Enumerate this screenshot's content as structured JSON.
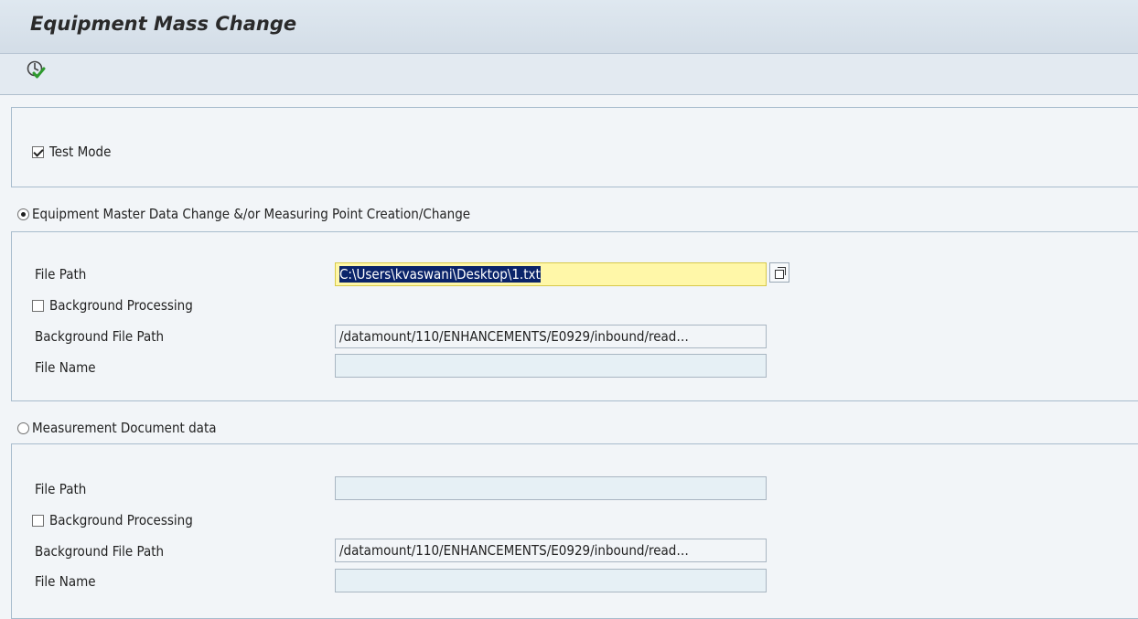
{
  "header": {
    "title": "Equipment Mass Change"
  },
  "toolbar": {
    "execute_icon": "execute-icon"
  },
  "options": {
    "test_mode_label": "Test Mode",
    "test_mode_checked": true
  },
  "section1": {
    "radio_label": "Equipment Master Data Change &/or Measuring Point Creation/Change",
    "selected": true,
    "file_path_label": "File Path",
    "file_path_value": "C:\\Users\\kvaswani\\Desktop\\1.txt",
    "background_processing_label": "Background Processing",
    "background_processing_checked": false,
    "background_file_path_label": "Background File Path",
    "background_file_path_value": "/datamount/110/ENHANCEMENTS/E0929/inbound/read…",
    "file_name_label": "File Name",
    "file_name_value": ""
  },
  "section2": {
    "radio_label": "Measurement Document data",
    "selected": false,
    "file_path_label": "File Path",
    "file_path_value": "",
    "background_processing_label": "Background Processing",
    "background_processing_checked": false,
    "background_file_path_label": "Background File Path",
    "background_file_path_value": "/datamount/110/ENHANCEMENTS/E0929/inbound/read…",
    "file_name_label": "File Name",
    "file_name_value": ""
  }
}
